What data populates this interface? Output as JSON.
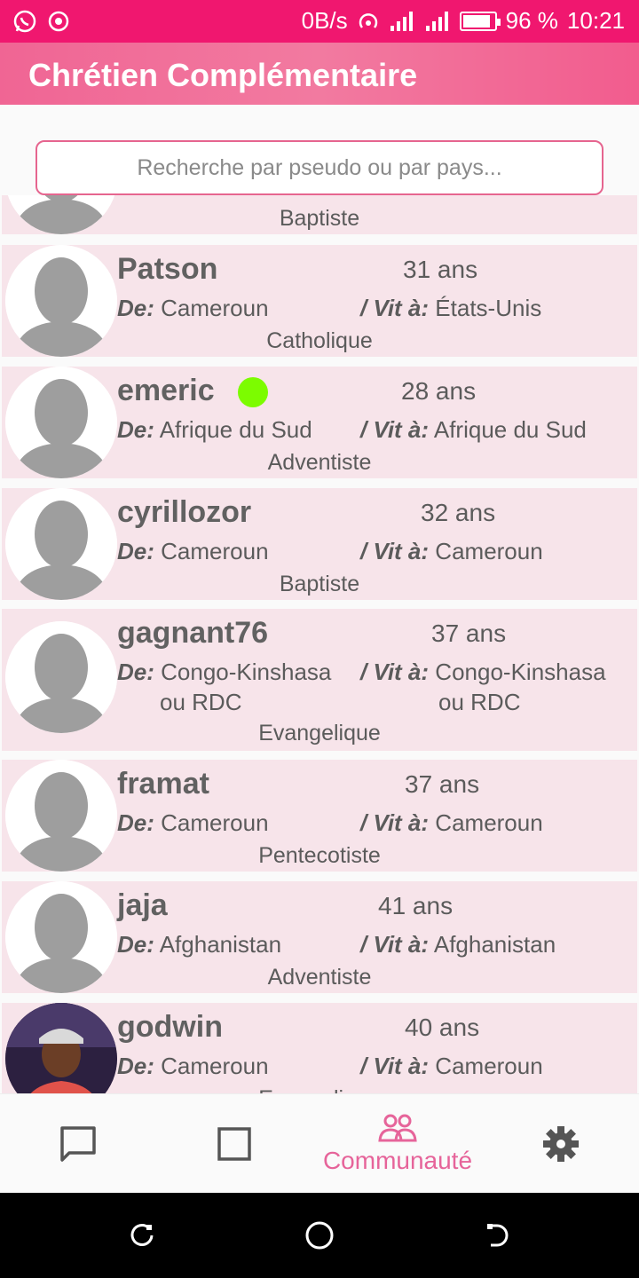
{
  "status_bar": {
    "network_speed": "0B/s",
    "battery_percent": "96 %",
    "time": "10:21"
  },
  "app": {
    "title": "Chrétien Complémentaire"
  },
  "search": {
    "placeholder": "Recherche par pseudo ou par pays..."
  },
  "labels": {
    "from": "De:",
    "lives": "/ Vit à:"
  },
  "partial_card": {
    "denomination": "Baptiste"
  },
  "profiles": [
    {
      "name": "Patson",
      "age": "31 ans",
      "from": "Cameroun",
      "lives": "États-Unis",
      "denomination": "Catholique"
    },
    {
      "name": "emeric",
      "age": "28 ans",
      "from": "Afrique du Sud",
      "lives": "Afrique du Sud",
      "denomination": "Adventiste"
    },
    {
      "name": "cyrillozor",
      "age": "32 ans",
      "from": "Cameroun",
      "lives": "Cameroun",
      "denomination": "Baptiste"
    },
    {
      "name": "gagnant76",
      "age": "37 ans",
      "from": "Congo-Kinshasa",
      "from_cont": "ou RDC",
      "lives": "Congo-Kinshasa",
      "lives_cont": "ou RDC",
      "denomination": "Evangelique"
    },
    {
      "name": "framat",
      "age": "37 ans",
      "from": "Cameroun",
      "lives": "Cameroun",
      "denomination": "Pentecotiste"
    },
    {
      "name": "jaja",
      "age": "41 ans",
      "from": "Afghanistan",
      "lives": "Afghanistan",
      "denomination": "Adventiste"
    },
    {
      "name": "godwin",
      "age": "40 ans",
      "from": "Cameroun",
      "lives": "Cameroun",
      "denomination": "Evangelique"
    }
  ],
  "bottom_nav": {
    "community_label": "Communauté",
    "active": "community",
    "items": [
      "chat-icon",
      "square-icon",
      "community-icon",
      "gear-icon"
    ],
    "accent_color": "#e6649a"
  },
  "colors": {
    "status_bar": "#f0176f",
    "app_bar": "#f06594",
    "card_bg": "#f7e4ea",
    "online": "#7cfc00"
  }
}
